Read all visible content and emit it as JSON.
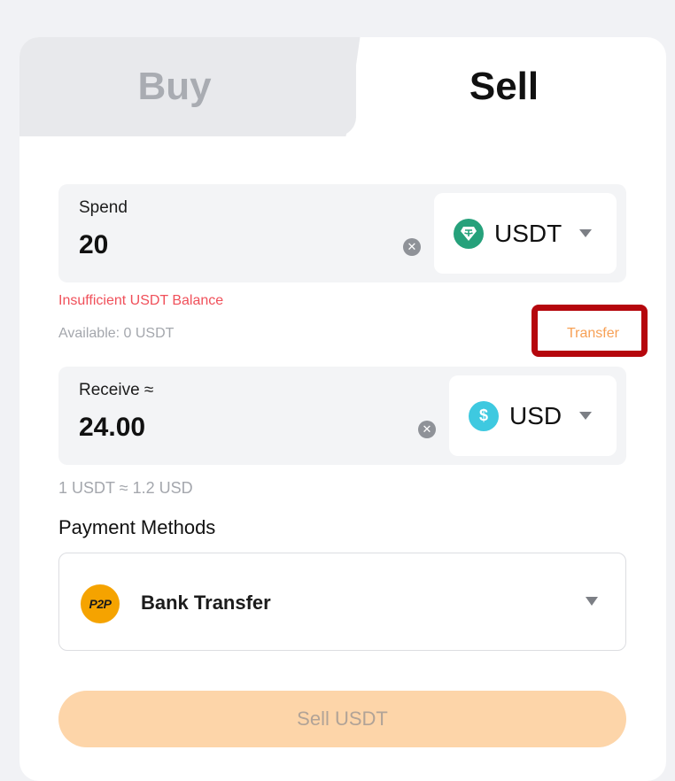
{
  "tabs": {
    "buy_label": "Buy",
    "sell_label": "Sell",
    "active": "Sell"
  },
  "spend": {
    "label": "Spend",
    "value": "20",
    "currency": "USDT",
    "currency_icon": "tether-icon",
    "currency_icon_color": "#26a17b"
  },
  "validation": {
    "error": "Insufficient USDT Balance",
    "available": "Available: 0 USDT",
    "transfer_label": "Transfer"
  },
  "receive": {
    "label": "Receive ≈",
    "value": "24.00",
    "currency": "USD",
    "currency_icon": "dollar-icon",
    "currency_icon_glyph": "$",
    "currency_icon_color": "#3ec9e0"
  },
  "rate_text": "1 USDT ≈ 1.2 USD",
  "payment": {
    "title": "Payment Methods",
    "icon_text": "P2P",
    "selected": "Bank Transfer"
  },
  "submit": {
    "label": "Sell USDT"
  },
  "colors": {
    "error": "#f0505a",
    "accent": "#f7a055",
    "button_disabled": "#fdd5a9",
    "highlight": "#b5070d"
  }
}
